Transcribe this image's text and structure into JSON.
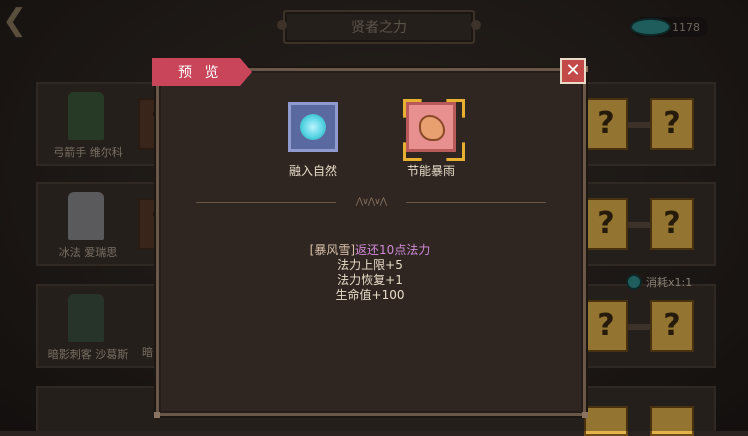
{
  "header": {
    "title": "贤者之力",
    "currency_value": "1178"
  },
  "heroes": [
    {
      "name": "弓箭手 维尔科"
    },
    {
      "name": "冰法 爱瑞思"
    },
    {
      "name": "暗影刺客 沙葛斯",
      "partner_name": "暗"
    }
  ],
  "cost_label": "消耗x1:1",
  "slot_glyph": "?",
  "modal": {
    "title": "预 览",
    "close_glyph": "✕",
    "items": [
      {
        "label": "融入自然",
        "icon": "nature-orb-icon",
        "color": "#5a6aa0"
      },
      {
        "label": "节能暴雨",
        "icon": "flexed-arm-icon",
        "color": "#e89090",
        "selected": true
      }
    ],
    "divider_glyph": "⋀∨⋀∨⋀",
    "effect": {
      "tag": "[暴风雪]",
      "tag_effect": "返还10点法力",
      "lines": [
        "法力上限+5",
        "法力恢复+1",
        "生命值+100"
      ]
    }
  },
  "colors": {
    "ribbon": "#c8455a",
    "highlight": "#d08ad8",
    "selection": "#e8b030"
  }
}
